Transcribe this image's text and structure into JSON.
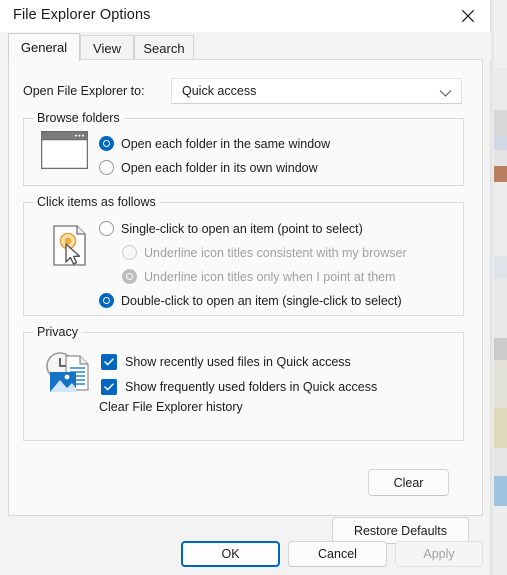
{
  "window": {
    "title": "File Explorer Options",
    "close_icon": "close-icon"
  },
  "tabs": [
    {
      "label": "General",
      "active": true
    },
    {
      "label": "View",
      "active": false
    },
    {
      "label": "Search",
      "active": false
    }
  ],
  "general": {
    "open_to": {
      "label": "Open File Explorer to:",
      "value": "Quick access",
      "chevron_icon": "chevron-down-icon"
    },
    "browse_folders": {
      "legend": "Browse folders",
      "icon": "window-icon",
      "options": [
        {
          "label": "Open each folder in the same window",
          "checked": true,
          "disabled": false
        },
        {
          "label": "Open each folder in its own window",
          "checked": false,
          "disabled": false
        }
      ]
    },
    "click_items": {
      "legend": "Click items as follows",
      "icon": "pointer-document-icon",
      "options": [
        {
          "label": "Single-click to open an item (point to select)",
          "checked": false,
          "disabled": false
        },
        {
          "label": "Underline icon titles consistent with my browser",
          "checked": false,
          "disabled": true
        },
        {
          "label": "Underline icon titles only when I point at them",
          "checked": true,
          "disabled": true
        },
        {
          "label": "Double-click to open an item (single-click to select)",
          "checked": true,
          "disabled": false
        }
      ]
    },
    "privacy": {
      "legend": "Privacy",
      "icon": "recent-files-icon",
      "checkboxes": [
        {
          "label": "Show recently used files in Quick access",
          "checked": true
        },
        {
          "label": "Show frequently used folders in Quick access",
          "checked": true
        }
      ],
      "clear_history_label": "Clear File Explorer history",
      "clear_button": "Clear"
    },
    "restore_defaults_button": "Restore Defaults"
  },
  "footer": {
    "ok": "OK",
    "cancel": "Cancel",
    "apply": "Apply"
  },
  "colors": {
    "accent": "#0067c0",
    "dialog_bg": "#f3f3f3",
    "panel_bg": "#fafafa",
    "disabled_text": "#a0a0a0"
  }
}
